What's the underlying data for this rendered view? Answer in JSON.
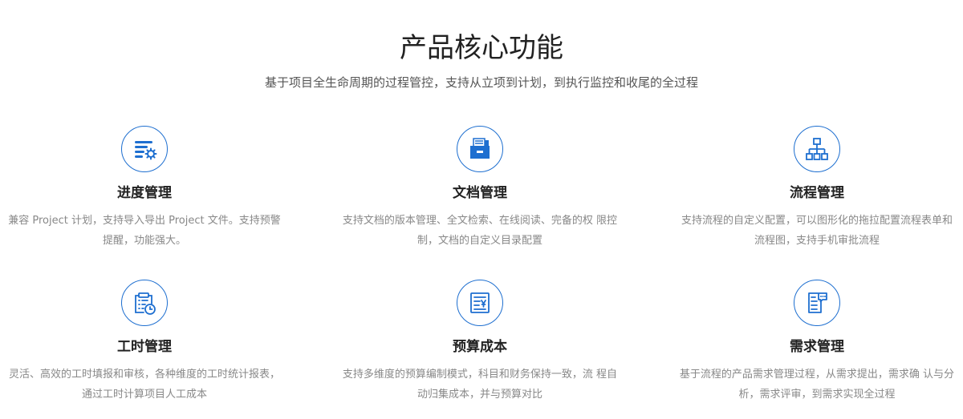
{
  "header": {
    "title": "产品核心功能",
    "subtitle": "基于项目全生命周期的过程管控，支持从立项到计划，到执行监控和收尾的全过程"
  },
  "colors": {
    "accent": "#1e6fd0",
    "title": "#222222",
    "subtitle": "#555555",
    "desc": "#888888"
  },
  "features": [
    {
      "title": "进度管理",
      "icon": "progress-gear-icon",
      "desc": "兼容 Project 计划，支持导入导出 Project 文件。支持预警提醒，功能强大。"
    },
    {
      "title": "文档管理",
      "icon": "document-folder-icon",
      "desc": "支持文档的版本管理、全文检索、在线阅读、完备的权 限控制，文档的自定义目录配置"
    },
    {
      "title": "流程管理",
      "icon": "flowchart-icon",
      "desc": "支持流程的自定义配置，可以图形化的拖拉配置流程表单和流程图，支持手机审批流程"
    },
    {
      "title": "工时管理",
      "icon": "timesheet-clock-icon",
      "desc": "灵活、高效的工时填报和审核，各种维度的工时统计报表， 通过工时计算项目人工成本"
    },
    {
      "title": "预算成本",
      "icon": "budget-yen-icon",
      "desc": "支持多维度的预算编制模式，科目和财务保持一致，流 程自动归集成本，并与预算对比"
    },
    {
      "title": "需求管理",
      "icon": "requirement-chat-icon",
      "desc": "基于流程的产品需求管理过程，从需求提出，需求确 认与分析，需求评审，到需求实现全过程"
    }
  ]
}
